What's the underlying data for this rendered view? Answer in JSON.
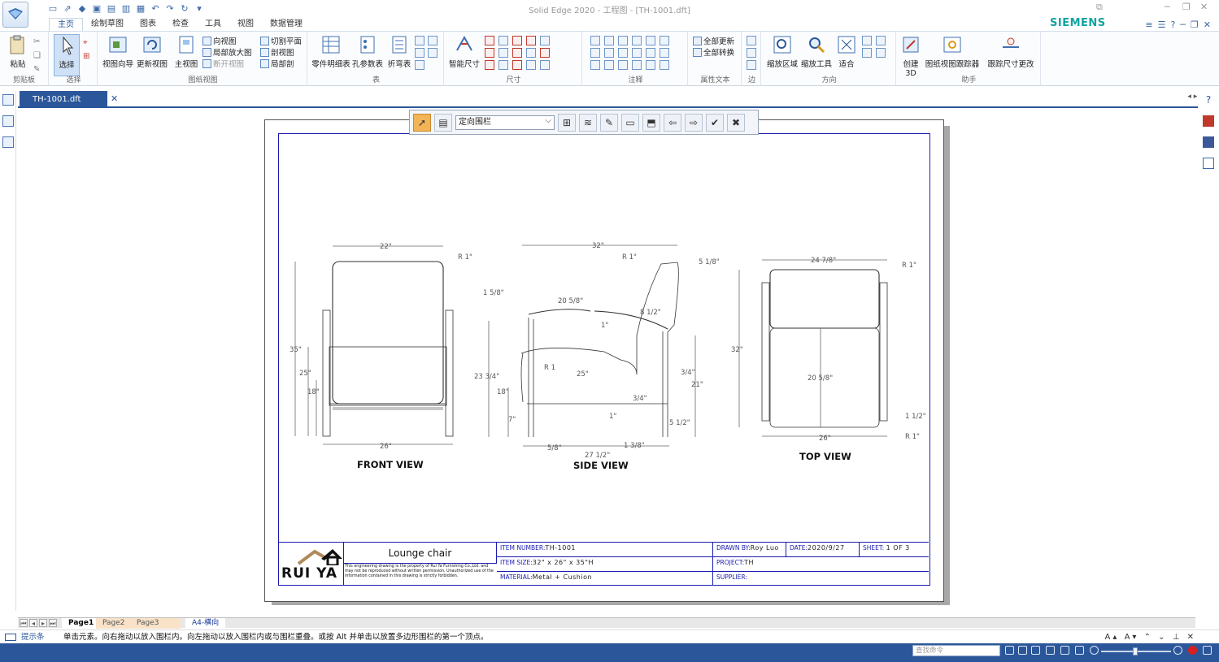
{
  "window": {
    "title": "Solid Edge 2020 - 工程图 - [TH-1001.dft]",
    "brand": "SIEMENS"
  },
  "ribbon": {
    "tabs": [
      "主页",
      "绘制草图",
      "图表",
      "检查",
      "工具",
      "视图",
      "数据管理"
    ],
    "active_tab": "主页",
    "groups": {
      "clipboard": {
        "label": "剪贴板",
        "paste": "粘贴"
      },
      "select": {
        "label": "选择",
        "select": "选择"
      },
      "drawing_views": {
        "label": "图纸视图",
        "view_wizard": "视图向导",
        "update_views": "更新视图",
        "main_view": "主视图",
        "projected_view": "向视图",
        "detail_view": "局部放大图",
        "broken_view": "断开视图",
        "cut_plane": "切割平面",
        "section_view": "剖视图",
        "broken_out": "局部剖"
      },
      "tables": {
        "label": "表",
        "parts_list": "零件明细表",
        "hole_table": "孔参数表",
        "bend_table": "折弯表"
      },
      "dimension": {
        "label": "尺寸",
        "smart_dimension": "智能尺寸"
      },
      "annotation": {
        "label": "注释"
      },
      "property_text": {
        "label": "属性文本",
        "update_all": "全部更新",
        "convert_all": "全部转换"
      },
      "edge": {
        "label": "边"
      },
      "orient": {
        "label": "方向",
        "zoom_area": "缩放区域",
        "zoom_tool": "缩放工具",
        "fit": "适合"
      },
      "assistant": {
        "label": "助手",
        "create_3d": "创建3D",
        "tracker": "图纸视图跟踪器",
        "track_changes": "跟踪尺寸更改"
      }
    }
  },
  "document": {
    "tab_name": "TH-1001.dft"
  },
  "fence_toolbar": {
    "mode_selected": "定向围栏"
  },
  "drawing": {
    "front_view": {
      "label": "FRONT VIEW",
      "dims": [
        "22\"",
        "R 1\"",
        "35\"",
        "25\"",
        "18\"",
        "26\""
      ]
    },
    "side_view": {
      "label": "SIDE VIEW",
      "dims": [
        "32\"",
        "R 1\"",
        "5 1/8\"",
        "1 5/8\"",
        "20 5/8\"",
        "8 1/2\"",
        "1\"",
        "R 1",
        "23 3/4\"",
        "25\"",
        "18\"",
        "7\"",
        "3/4\"",
        "21\"",
        "3/4\"",
        "1\"",
        "5 1/2\"",
        "5/8\"",
        "1 3/8\"",
        "27 1/2\""
      ]
    },
    "top_view": {
      "label": "TOP VIEW",
      "dims": [
        "24 7/8\"",
        "R 1\"",
        "32\"",
        "20 5/8\"",
        "1 1/2\"",
        "26\"",
        "R 1\""
      ]
    }
  },
  "title_block": {
    "logo_text": "RUI YA",
    "title": "Lounge chair",
    "note": "This engineering drawing is the property of Rui Ya Furnishing Co.,Ltd. and may not be reproduced without written permission. Unauthorized use of the information contained in this drawing is strictly forbidden.",
    "item_number_label": "ITEM NUMBER:",
    "item_number": "TH-1001",
    "item_size_label": "ITEM SIZE:",
    "item_size": "32\" x 26\" x 35\"H",
    "material_label": "MATERIAL:",
    "material": "Metal + Cushion",
    "drawn_by_label": "DRAWN BY:",
    "drawn_by": "Roy Luo",
    "date_label": "DATE:",
    "date": "2020/9/27",
    "sheet_label": "SHEET:",
    "sheet": "1 OF 3",
    "project_label": "PROJECT:",
    "project": "TH",
    "supplier_label": "SUPPLIER:",
    "supplier": ""
  },
  "sheet_tabs": [
    "Page1",
    "Page2",
    "Page3",
    "A4-横向"
  ],
  "status": {
    "prompt_label": "提示条",
    "prompt": "单击元素。向右拖动以放入围栏内。向左拖动以放入围栏内或与围栏重叠。或按 Alt 并单击以放置多边形围栏的第一个顶点。",
    "find_placeholder": "查找命令"
  },
  "colors": {
    "accent": "#2b579a",
    "border_blue": "#1b1bb3",
    "siemens_teal": "#12a3a0"
  }
}
